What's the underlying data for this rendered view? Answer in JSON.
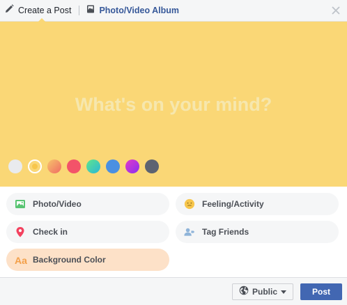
{
  "header": {
    "create_post_label": "Create a Post",
    "album_label": "Photo/Video Album"
  },
  "composer": {
    "placeholder": "What's on your mind?",
    "background_color": "#fad776",
    "swatches": [
      {
        "name": "white",
        "color": "#e9ebee"
      },
      {
        "name": "yellow",
        "color": "#fad776",
        "selected": true
      },
      {
        "name": "orange-gradient",
        "color": "#f5a466"
      },
      {
        "name": "red",
        "color": "#f35369"
      },
      {
        "name": "teal-green",
        "color": "#3bcfb0"
      },
      {
        "name": "blue",
        "color": "#4a90e2"
      },
      {
        "name": "purple",
        "color": "#b02ef2"
      },
      {
        "name": "gray",
        "color": "#5d6371"
      }
    ]
  },
  "options": {
    "photo_video": "Photo/Video",
    "feeling_activity": "Feeling/Activity",
    "check_in": "Check in",
    "tag_friends": "Tag Friends",
    "background_color": "Background Color"
  },
  "footer": {
    "audience_label": "Public",
    "post_label": "Post"
  },
  "colors": {
    "accent": "#4267b2",
    "link": "#365899"
  }
}
